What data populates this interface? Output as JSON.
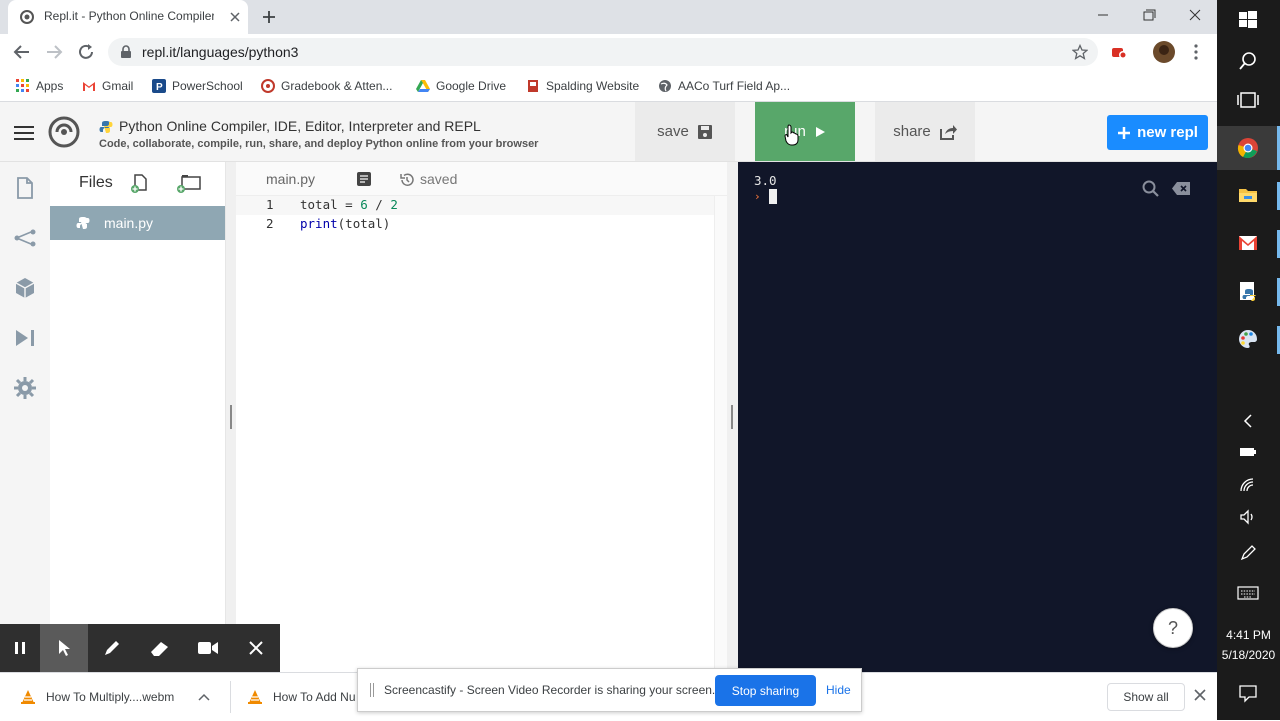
{
  "browser": {
    "tab_title": "Repl.it - Python Online Compiler",
    "url": "repl.it/languages/python3"
  },
  "bookmarks": [
    {
      "label": "Apps",
      "icon": "apps-grid-icon"
    },
    {
      "label": "Gmail",
      "icon": "gmail-icon"
    },
    {
      "label": "PowerSchool",
      "icon": "powerschool-icon"
    },
    {
      "label": "Gradebook & Atten...",
      "icon": "gradebook-icon"
    },
    {
      "label": "Google Drive",
      "icon": "google-drive-icon"
    },
    {
      "label": "Spalding Website",
      "icon": "spalding-icon"
    },
    {
      "label": "AACo Turf Field Ap...",
      "icon": "globe-icon"
    }
  ],
  "repl": {
    "title": "Python Online Compiler, IDE, Editor, Interpreter and REPL",
    "subtitle": "Code, collaborate, compile, run, share, and deploy Python online from your browser",
    "save_label": "save",
    "run_label": "run",
    "share_label": "share",
    "new_repl_label": "new repl"
  },
  "files": {
    "header": "Files",
    "items": [
      "main.py"
    ]
  },
  "editor": {
    "tab_name": "main.py",
    "status": "saved",
    "lines": [
      {
        "n": "1",
        "tokens": [
          {
            "t": "total = ",
            "c": "plain"
          },
          {
            "t": "6",
            "c": "num"
          },
          {
            "t": " / ",
            "c": "plain"
          },
          {
            "t": "2",
            "c": "num"
          }
        ]
      },
      {
        "n": "2",
        "tokens": [
          {
            "t": "print",
            "c": "fn"
          },
          {
            "t": "(total)",
            "c": "plain"
          }
        ]
      }
    ]
  },
  "console": {
    "output": "3.0",
    "prompt": "›"
  },
  "help_label": "?",
  "downloads": [
    {
      "name": "How To Multiply....webm"
    },
    {
      "name": "How To Add Nu"
    }
  ],
  "downloads_show_all": "Show all",
  "sharing_banner": {
    "text": "Screencastify - Screen Video Recorder is sharing your screen.",
    "stop_label": "Stop sharing",
    "hide_label": "Hide"
  },
  "taskbar": {
    "time": "4:41 PM",
    "date": "5/18/2020"
  },
  "colors": {
    "run_green": "#58a76a",
    "new_repl_blue": "#1a8cff",
    "console_bg": "#111629",
    "file_selected": "#8fa7b3"
  }
}
